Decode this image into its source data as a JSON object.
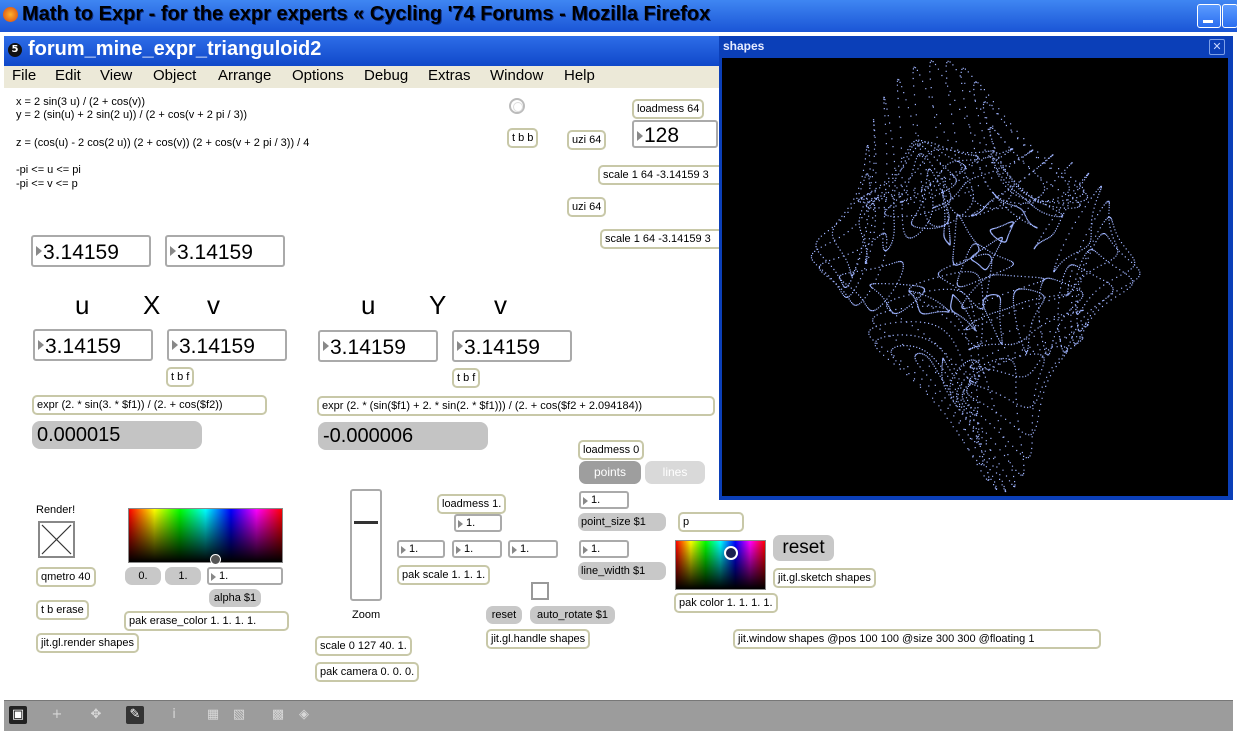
{
  "browser": {
    "title": "Math to Expr - for the expr experts « Cycling '74 Forums - Mozilla Firefox"
  },
  "patcher": {
    "title": "forum_mine_expr_trianguloid2",
    "menu": [
      "File",
      "Edit",
      "View",
      "Object",
      "Arrange",
      "Options",
      "Debug",
      "Extras",
      "Window",
      "Help"
    ],
    "comments": {
      "line1": "x = 2 sin(3 u) / (2 + cos(v))",
      "line2": "y = 2 (sin(u) + 2 sin(2 u)) / (2 + cos(v + 2 pi / 3))",
      "line3": "z = (cos(u) - 2 cos(2 u)) (2 + cos(v)) (2 + cos(v + 2 pi / 3)) / 4",
      "line4": "-pi <= u <= pi",
      "line5": "-pi <= v <= p",
      "render": "Render!",
      "zoom": "Zoom"
    },
    "labels": {
      "u1": "u",
      "x": "X",
      "v1": "v",
      "u2": "u",
      "y": "Y",
      "v2": "v"
    },
    "numbers": {
      "top_u": "3.14159",
      "top_v": "3.14159",
      "x_u": "3.14159",
      "x_v": "3.14159",
      "y_u": "3.14159",
      "y_v": "3.14159",
      "count": "128",
      "x_result": "0.000015",
      "y_result": "-0.000006",
      "scale_a": "1.",
      "scale_b": "1.",
      "scale_c": "1.",
      "loadmess1_num": "1.",
      "point_size_num": "1.",
      "line_width_num": "1.",
      "alpha_num": "1."
    },
    "objects": {
      "tbb": "t b b",
      "uzi1": "uzi 64",
      "uzi2": "uzi 64",
      "loadmess64": "loadmess 64",
      "scale1": "scale 1 64 -3.14159 3",
      "scale2": "scale 1 64 -3.14159 3",
      "tbf1": "t b f",
      "tbf2": "t b f",
      "expr_x": "expr (2. * sin(3. * $f1)) / (2. + cos($f2))",
      "expr_y": "expr (2. * (sin($f1) + 2. * sin(2. * $f1))) / (2. + cos($f2 + 2.094184))",
      "loadmess0": "loadmess 0",
      "loadmess1": "loadmess 1.",
      "point_size": "point_size $1",
      "line_width": "line_width $1",
      "p": "p",
      "pak_scale": "pak scale 1. 1. 1.",
      "qmetro": "qmetro 40",
      "t_b_erase": "t b erase",
      "pak_erase_color": "pak erase_color 1. 1. 1. 1.",
      "jit_render": "jit.gl.render shapes",
      "scale_zoom": "scale 0 127 40. 1.",
      "pak_camera": "pak camera 0. 0. 0.",
      "jit_handle": "jit.gl.handle shapes",
      "pak_color": "pak color 1. 1. 1. 1.",
      "jit_sketch": "jit.gl.sketch shapes",
      "jit_window": "jit.window shapes @pos 100 100 @size 300 300 @floating 1"
    },
    "messages": {
      "points": "points",
      "lines": "lines",
      "reset_big": "reset",
      "reset_small": "reset",
      "auto_rotate": "auto_rotate $1",
      "alpha": "alpha $1",
      "zero": "0.",
      "one": "1."
    }
  },
  "shapes_window": {
    "title": "shapes"
  },
  "colors": {
    "title_blue": "#1a55d6",
    "point_blue": "#9fb4ff",
    "object_border": "#c8c8a8"
  }
}
